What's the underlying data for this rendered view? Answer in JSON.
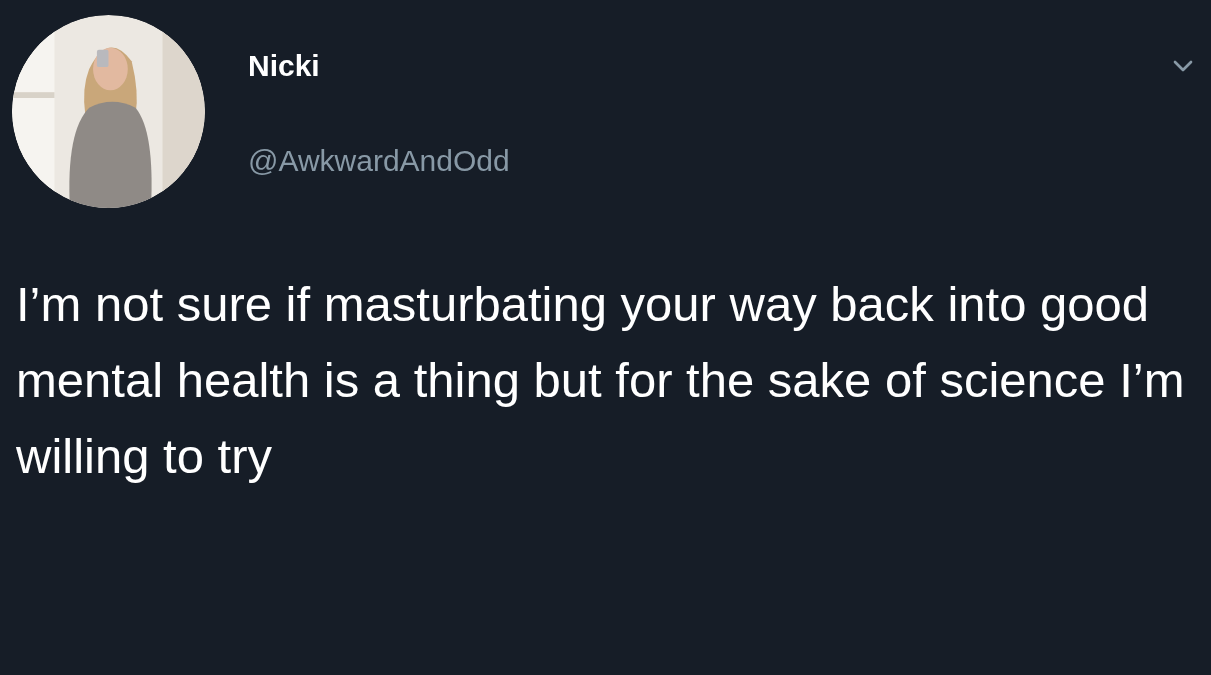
{
  "tweet": {
    "author": {
      "name": "Nicki",
      "handle": "@AwkwardAndOdd"
    },
    "text": "I’m not sure if masturbating your way back into good mental health is a thing but for the sake of science I’m willing to try"
  }
}
